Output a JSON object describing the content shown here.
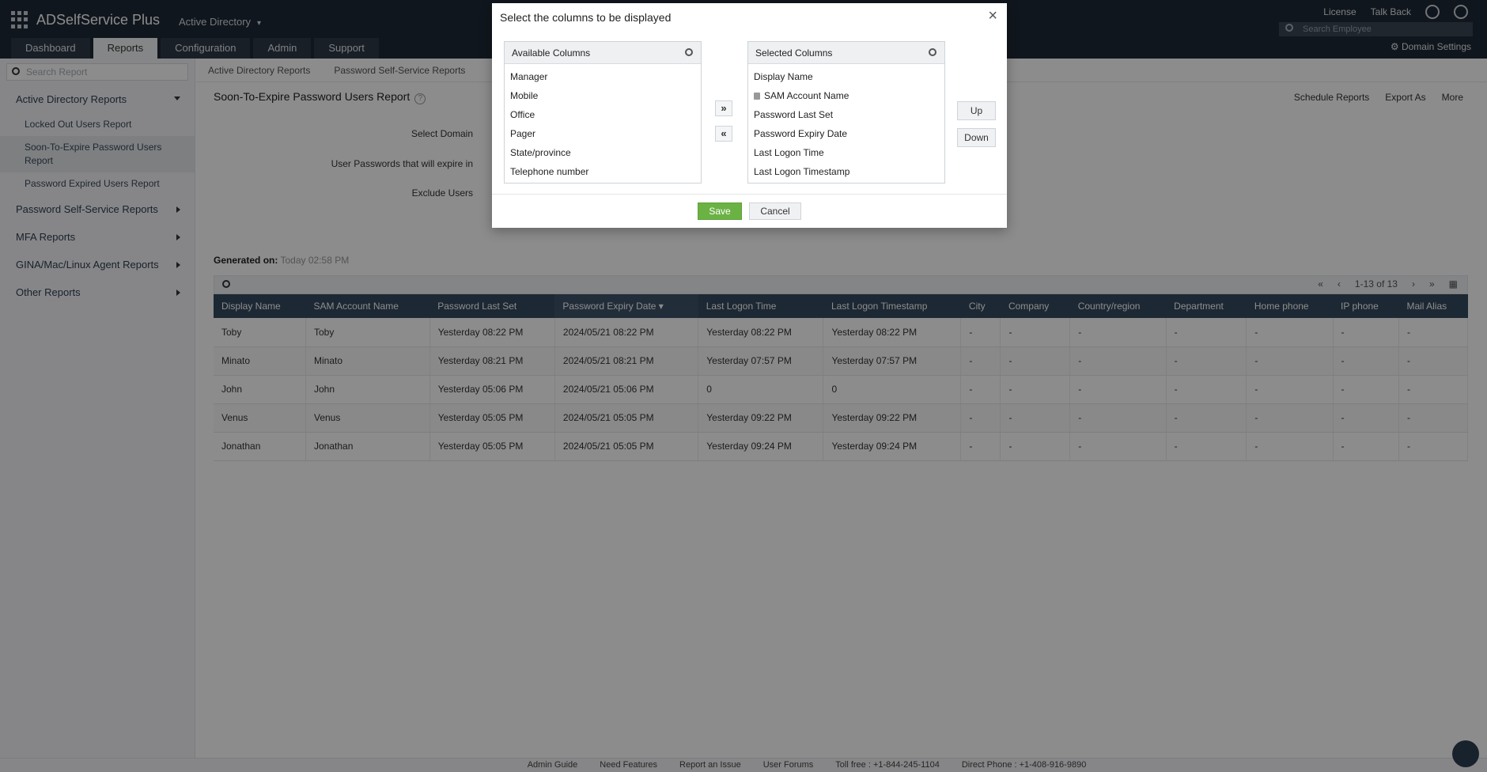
{
  "app": {
    "name": "ADSelfService Plus",
    "module": "Active Directory",
    "tabs": [
      "Dashboard",
      "Reports",
      "Configuration",
      "Admin",
      "Support"
    ],
    "active_tab": "Reports",
    "top_links": {
      "license": "License",
      "talk_back": "Talk Back"
    },
    "employee_search_placeholder": "Search Employee",
    "domain_settings": "Domain Settings"
  },
  "sidebar": {
    "search_placeholder": "Search Report",
    "groups": [
      {
        "label": "Active Directory Reports",
        "expanded": true
      },
      {
        "label": "Password Self-Service Reports"
      },
      {
        "label": "MFA Reports"
      },
      {
        "label": "GINA/Mac/Linux Agent Reports"
      },
      {
        "label": "Other Reports"
      }
    ],
    "items": [
      {
        "label": "Locked Out Users Report"
      },
      {
        "label": "Soon-To-Expire Password Users Report",
        "active": true
      },
      {
        "label": "Password Expired Users Report"
      }
    ]
  },
  "subnav": {
    "ad_reports": "Active Directory Reports",
    "pss_reports": "Password Self-Service Reports"
  },
  "report": {
    "title": "Soon-To-Expire Password Users Report",
    "actions": {
      "schedule": "Schedule Reports",
      "export": "Export As",
      "more": "More"
    },
    "form_labels": {
      "domain": "Select Domain",
      "expire_in": "User Passwords that will expire in",
      "exclude": "Exclude Users"
    },
    "generated_label": "Generated on:",
    "generated_value": "Today 02:58 PM",
    "pager": "1-13 of 13",
    "columns": [
      "Display Name",
      "SAM Account Name",
      "Password Last Set",
      "Password Expiry Date",
      "Last Logon Time",
      "Last Logon Timestamp",
      "City",
      "Company",
      "Country/region",
      "Department",
      "Home phone",
      "IP phone",
      "Mail Alias"
    ],
    "rows": [
      [
        "Toby",
        "Toby",
        "Yesterday 08:22 PM",
        "2024/05/21 08:22 PM",
        "Yesterday 08:22 PM",
        "Yesterday 08:22 PM",
        "-",
        "-",
        "-",
        "-",
        "-",
        "-",
        "-"
      ],
      [
        "Minato",
        "Minato",
        "Yesterday 08:21 PM",
        "2024/05/21 08:21 PM",
        "Yesterday 07:57 PM",
        "Yesterday 07:57 PM",
        "-",
        "-",
        "-",
        "-",
        "-",
        "-",
        "-"
      ],
      [
        "John",
        "John",
        "Yesterday 05:06 PM",
        "2024/05/21 05:06 PM",
        "0",
        "0",
        "-",
        "-",
        "-",
        "-",
        "-",
        "-",
        "-"
      ],
      [
        "Venus",
        "Venus",
        "Yesterday 05:05 PM",
        "2024/05/21 05:05 PM",
        "Yesterday 09:22 PM",
        "Yesterday 09:22 PM",
        "-",
        "-",
        "-",
        "-",
        "-",
        "-",
        "-"
      ],
      [
        "Jonathan",
        "Jonathan",
        "Yesterday 05:05 PM",
        "2024/05/21 05:05 PM",
        "Yesterday 09:24 PM",
        "Yesterday 09:24 PM",
        "-",
        "-",
        "-",
        "-",
        "-",
        "-",
        "-"
      ]
    ]
  },
  "footer": [
    "Admin Guide",
    "Need Features",
    "Report an Issue",
    "User Forums",
    "Toll free : +1-844-245-1104",
    "Direct Phone : +1-408-916-9890"
  ],
  "modal": {
    "title": "Select the columns to be displayed",
    "available_header": "Available Columns",
    "available": [
      "Manager",
      "Mobile",
      "Office",
      "Pager",
      "State/province",
      "Telephone number"
    ],
    "selected_header": "Selected Columns",
    "selected": [
      "Display Name",
      "SAM Account Name",
      "Password Last Set",
      "Password Expiry Date",
      "Last Logon Time",
      "Last Logon Timestamp"
    ],
    "add_label": "»",
    "remove_label": "«",
    "up_label": "Up",
    "down_label": "Down",
    "save_label": "Save",
    "cancel_label": "Cancel",
    "close_label": "×"
  },
  "colors": {
    "header_bg": "#1e2835",
    "table_header": "#34495e",
    "save": "#6bb244"
  }
}
